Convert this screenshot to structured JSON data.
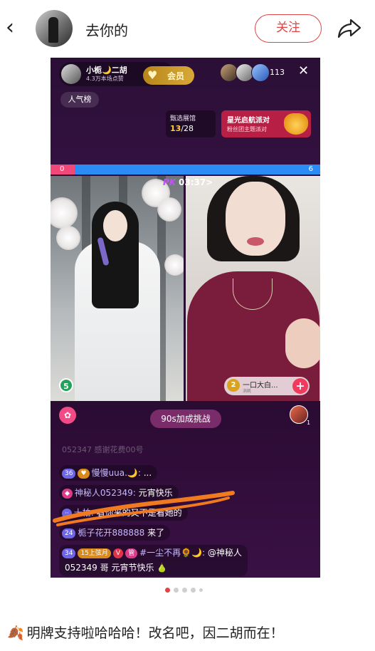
{
  "header": {
    "back_icon": "‹",
    "username": "去你的",
    "follow_label": "关注",
    "share_icon": "share-arrow"
  },
  "live": {
    "host_name": "小栀🌙二胡",
    "host_likes": "4.3万本场点赞",
    "vip_label": "会员",
    "viewer_count": "113",
    "close_icon": "✕",
    "rank_label": "人气榜",
    "selection": {
      "title": "甄选展馆",
      "current": "13",
      "total": "/28"
    },
    "star_event": {
      "title": "星光启航派对",
      "subtitle": "粉丝团主题派对"
    },
    "pk": {
      "left_score": "0",
      "right_score": "6",
      "logo": "PK",
      "timer": "03:37>"
    },
    "left_score_badge": "5",
    "gift": {
      "num": "2",
      "name": "一口大白...",
      "sub": "消耗",
      "plus": "+"
    },
    "challenge_label": "90s加成挑战",
    "opponent_rank": "1",
    "faded_comment": "052347 感谢花费00号 ",
    "comments": [
      {
        "lv": "36",
        "badges": [
          "♥"
        ],
        "name": "慢慢uua.🌙:",
        "text": " ..."
      },
      {
        "lv": "",
        "badges": [],
        "name": "神秘人052349:",
        "text": " 元宵快乐"
      },
      {
        "lv": "",
        "badges": [],
        "name": "十柏:",
        "text": " 看你来的又不是看她的"
      },
      {
        "lv": "24",
        "badges": [],
        "name": "栀子花开888888",
        "text": " 来了"
      },
      {
        "lv": "34",
        "badges": [
          "15上弦月",
          "V",
          "管"
        ],
        "name": "#一尘不再🌻🌙:",
        "text": " @神秘人"
      }
    ],
    "comment_cont": "052349 哥 元宵节快乐 🍐"
  },
  "pagination": {
    "count": 5,
    "active": 0
  },
  "caption": "明牌支持啦哈哈哈！改名吧，因二胡而在！",
  "colors": {
    "accent_red": "#e04545",
    "pk_red": "#f1487a",
    "pk_blue": "#2b8cf5",
    "bg_purple": "#2a0d33",
    "scribble": "#f07a1f"
  }
}
